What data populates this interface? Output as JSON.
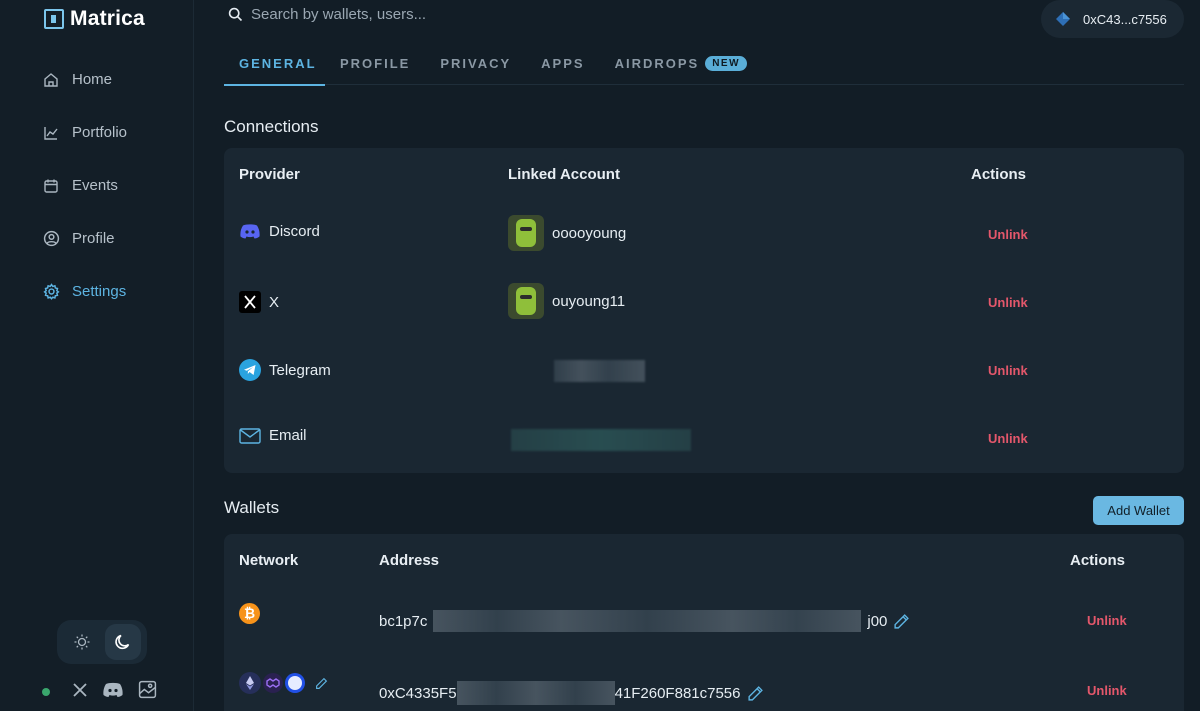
{
  "app": {
    "name": "Matrica"
  },
  "sidebar": {
    "items": [
      {
        "label": "Home",
        "icon": "home-icon",
        "active": false
      },
      {
        "label": "Portfolio",
        "icon": "chart-icon",
        "active": false
      },
      {
        "label": "Events",
        "icon": "calendar-icon",
        "active": false
      },
      {
        "label": "Profile",
        "icon": "user-circle-icon",
        "active": false
      },
      {
        "label": "Settings",
        "icon": "gear-icon",
        "active": true
      }
    ]
  },
  "search": {
    "placeholder": "Search by wallets, users..."
  },
  "wallet_pill": {
    "address": "0xC43...c7556"
  },
  "tabs": [
    {
      "label": "GENERAL",
      "active": true
    },
    {
      "label": "PROFILE"
    },
    {
      "label": "PRIVACY"
    },
    {
      "label": "APPS"
    },
    {
      "label": "AIRDROPS",
      "badge": "NEW"
    }
  ],
  "connections": {
    "title": "Connections",
    "headers": {
      "provider": "Provider",
      "account": "Linked Account",
      "actions": "Actions"
    },
    "rows": [
      {
        "provider": "Discord",
        "account": "ooooyoung",
        "action": "Unlink"
      },
      {
        "provider": "X",
        "account": "ouyoung11",
        "action": "Unlink"
      },
      {
        "provider": "Telegram",
        "account": "",
        "action": "Unlink"
      },
      {
        "provider": "Email",
        "account": "",
        "action": "Unlink"
      }
    ]
  },
  "wallets": {
    "title": "Wallets",
    "add_label": "Add Wallet",
    "headers": {
      "network": "Network",
      "address": "Address",
      "actions": "Actions"
    },
    "rows": [
      {
        "prefix": "bc1p7c",
        "suffix": "j00",
        "action": "Unlink"
      },
      {
        "prefix": "0xC4335F5",
        "suffix": "41F260F881c7556",
        "action": "Unlink"
      }
    ]
  },
  "colors": {
    "accent": "#5db4e2",
    "danger": "#e4576b",
    "bg": "#121d26",
    "card": "#1a2732"
  }
}
